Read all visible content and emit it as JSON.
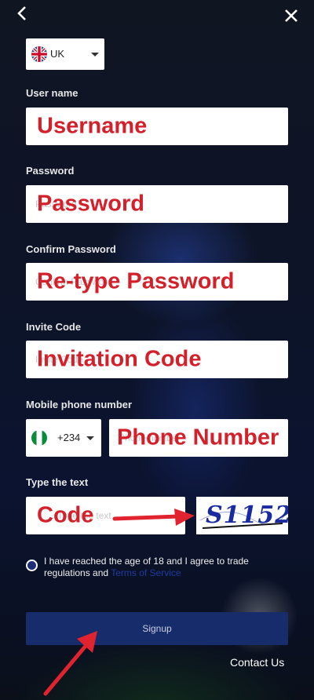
{
  "nav": {
    "back_icon": "chevron-left-icon",
    "close_icon": "close-icon"
  },
  "country": {
    "code": "UK",
    "flag": "uk-flag-icon"
  },
  "username": {
    "label": "User name",
    "annotation": "Username"
  },
  "password": {
    "label": "Password",
    "placeholder": "Password",
    "annotation": "Password"
  },
  "confirm_password": {
    "label": "Confirm Password",
    "placeholder": "Confirm Password",
    "annotation": "Re-type Password"
  },
  "invite": {
    "label": "Invite Code",
    "placeholder": "Invite Code",
    "annotation": "Invitation Code"
  },
  "mobile": {
    "label": "Mobile phone number",
    "dial_code": "+234",
    "placeholder": "Phone number",
    "annotation": "Phone Number"
  },
  "captcha": {
    "label": "Type the text",
    "placeholder": "Type the text",
    "annotation": "Code",
    "image_text": "S1152"
  },
  "agreement": {
    "text": "I have reached the age of 18 and I agree to trade regulations and",
    "link": "Terms of Service"
  },
  "signup_label": "Signup",
  "contact_label": "Contact Us",
  "colors": {
    "annotation_red": "#d3202a",
    "signup_bg": "#172c6a",
    "link": "#1f3a9e"
  }
}
